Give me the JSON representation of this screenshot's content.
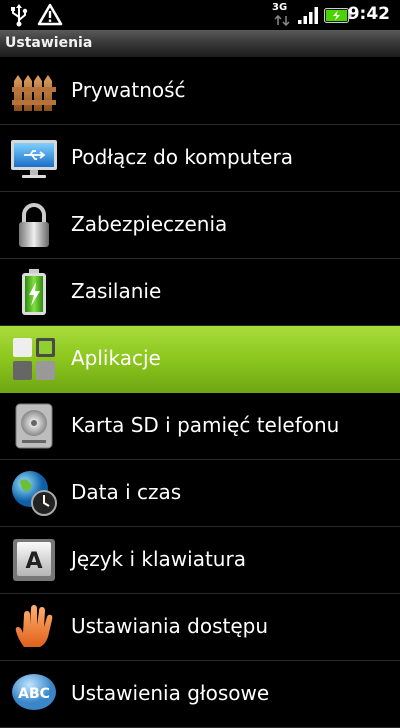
{
  "status_bar": {
    "time": "9:42",
    "network": "3G",
    "icons": [
      "usb-icon",
      "warning-icon",
      "network-3g-icon",
      "signal-icon",
      "battery-charging-icon"
    ],
    "battery_color": "#4cd400"
  },
  "title_bar": {
    "title": "Ustawienia"
  },
  "accent_color": "#8cc61e",
  "menu": {
    "items": [
      {
        "label": "Prywatność",
        "icon": "fence-icon"
      },
      {
        "label": "Podłącz do komputera",
        "icon": "monitor-usb-icon"
      },
      {
        "label": "Zabezpieczenia",
        "icon": "padlock-icon"
      },
      {
        "label": "Zasilanie",
        "icon": "battery-icon"
      },
      {
        "label": "Aplikacje",
        "icon": "apps-grid-icon",
        "selected": true
      },
      {
        "label": "Karta SD i pamięć telefonu",
        "icon": "sd-storage-icon"
      },
      {
        "label": "Data i czas",
        "icon": "globe-clock-icon"
      },
      {
        "label": "Język i klawiatura",
        "icon": "keyboard-key-icon"
      },
      {
        "label": "Ustawiania dostępu",
        "icon": "hand-icon"
      },
      {
        "label": "Ustawienia głosowe",
        "icon": "abc-speech-icon"
      }
    ]
  }
}
